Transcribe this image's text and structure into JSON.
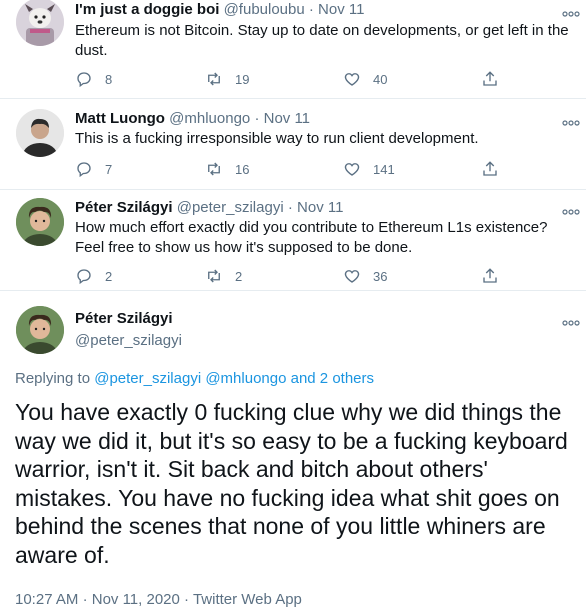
{
  "replies": [
    {
      "name": "I'm just a doggie boi",
      "handle": "@fubuloubu",
      "separator": "·",
      "date": "Nov 11",
      "text": "Ethereum is not Bitcoin. Stay up to date on developments, or get left in the dust.",
      "replies": "8",
      "retweets": "19",
      "likes": "40",
      "avatar_icon": "doggie-avatar-icon"
    },
    {
      "name": "Matt Luongo",
      "handle": "@mhluongo",
      "separator": "·",
      "date": "Nov 11",
      "text": "This is a fucking irresponsible way to run client development.",
      "replies": "7",
      "retweets": "16",
      "likes": "141",
      "avatar_icon": "person-avatar-icon"
    },
    {
      "name": "Péter Szilágyi",
      "handle": "@peter_szilagyi",
      "separator": "·",
      "date": "Nov 11",
      "text": "How much effort exactly did you contribute to Ethereum L1s existence? Feel free to show us how it's supposed to be done.",
      "replies": "2",
      "retweets": "2",
      "likes": "36",
      "avatar_icon": "person-avatar-icon"
    }
  ],
  "main_tweet": {
    "name": "Péter Szilágyi",
    "handle": "@peter_szilagyi",
    "replying_prefix": "Replying to",
    "replying_users": "@peter_szilagyi @mhluongo",
    "replying_others": "and 2 others",
    "text": "You have exactly 0 fucking clue why we did things the way we did it, but it's so easy to be a fucking keyboard warrior, isn't it. Sit back and bitch about others' mistakes. You have no fucking idea what shit goes on behind the scenes that none of you little whiners are aware of.",
    "time": "10:27 AM",
    "separator": "·",
    "date": "Nov 11, 2020",
    "source": "Twitter Web App"
  },
  "colors": {
    "text": "#0f1419",
    "secondary": "#5b7083",
    "link": "#1b95e0",
    "divider": "#e6ecf0"
  }
}
